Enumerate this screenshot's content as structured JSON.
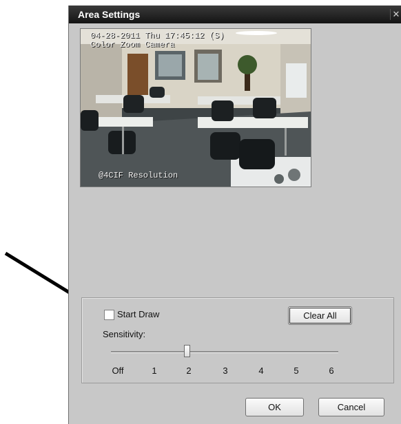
{
  "window": {
    "title": "Area Settings",
    "close_glyph": "✕",
    "close_icon": "close-icon"
  },
  "camera": {
    "osd_date": "04-28-2011 Thu 17:45:12 (S)",
    "osd_camera": "Color Zoom Camera",
    "osd_resolution": "@4CIF Resolution"
  },
  "area": {
    "start_draw_label": "Start Draw",
    "start_draw_checked": false,
    "clear_all_label": "Clear All",
    "sensitivity_label": "Sensitivity:",
    "sensitivity_ticks": [
      "Off",
      "1",
      "2",
      "3",
      "4",
      "5",
      "6"
    ],
    "sensitivity_value": "2"
  },
  "footer": {
    "ok_label": "OK",
    "cancel_label": "Cancel"
  },
  "annotation": {
    "arrow_icon": "pointer-arrow-icon",
    "arrow_color": "#000000"
  }
}
